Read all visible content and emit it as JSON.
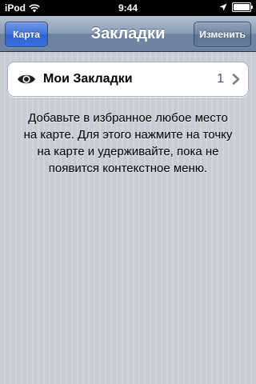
{
  "status_bar": {
    "carrier": "iPod",
    "time": "9:44",
    "battery_level": 1.0
  },
  "nav": {
    "title": "Закладки",
    "left_button": "Карта",
    "right_button": "Изменить"
  },
  "bookmarks": {
    "item": {
      "icon": "eye-icon",
      "label": "Мои Закладки",
      "count": "1"
    }
  },
  "message": "Добавьте в избранное любое место на карте. Для этого нажмите на точку на карте и удерживайте, пока не появится контекстное меню.",
  "colors": {
    "nav_accent": "#3a6fe0",
    "count_text": "#385487"
  }
}
